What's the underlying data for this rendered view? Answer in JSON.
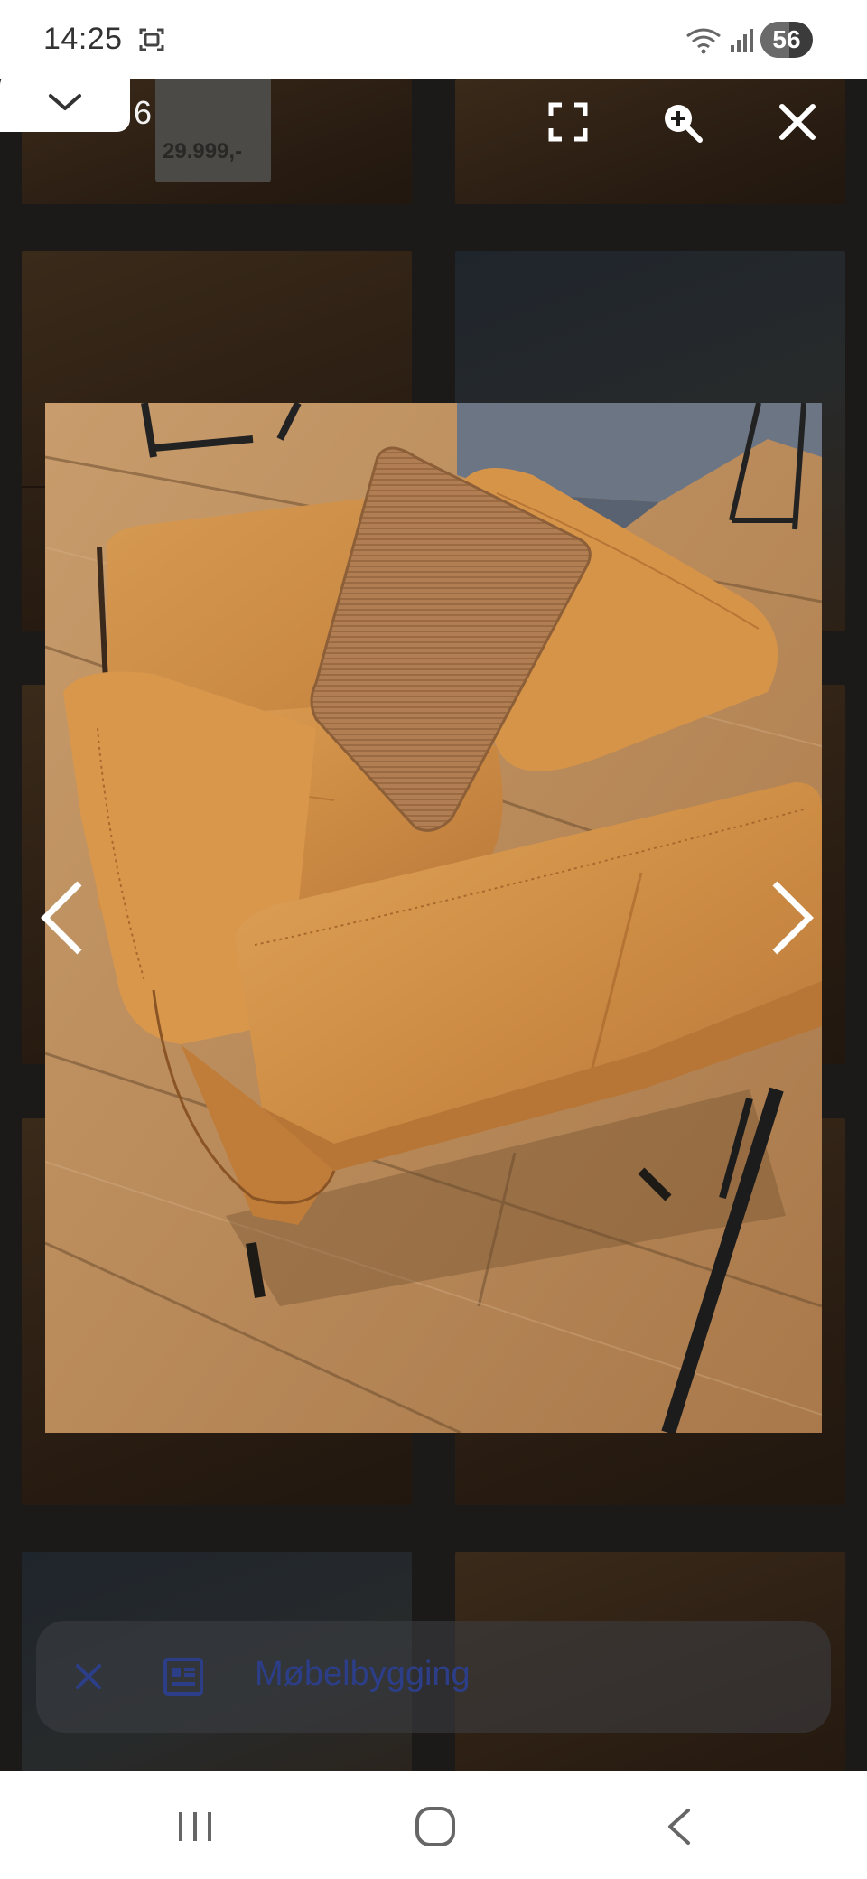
{
  "status_bar": {
    "time": "14:25",
    "battery": "56",
    "battery_level": 0.56
  },
  "viewer": {
    "counter": "6",
    "toolbar": {
      "collapse_icon": "chevron-down-icon",
      "fullscreen_icon": "fullscreen-icon",
      "zoom_icon": "zoom-in-icon",
      "close_icon": "close-icon"
    },
    "prev_icon": "chevron-left-icon",
    "next_icon": "chevron-right-icon"
  },
  "background": {
    "price_tag": "29.999,-"
  },
  "chip": {
    "label": "Møbelbygging",
    "close_icon": "close-icon",
    "doc_icon": "article-icon"
  },
  "navbar": {
    "recents_icon": "recents-icon",
    "home_icon": "home-icon",
    "back_icon": "back-icon"
  },
  "colors": {
    "leather": "#cf8e45",
    "floor": "#b6875a",
    "scrim": "#1b1a19",
    "chip_text": "#2c3e88"
  }
}
